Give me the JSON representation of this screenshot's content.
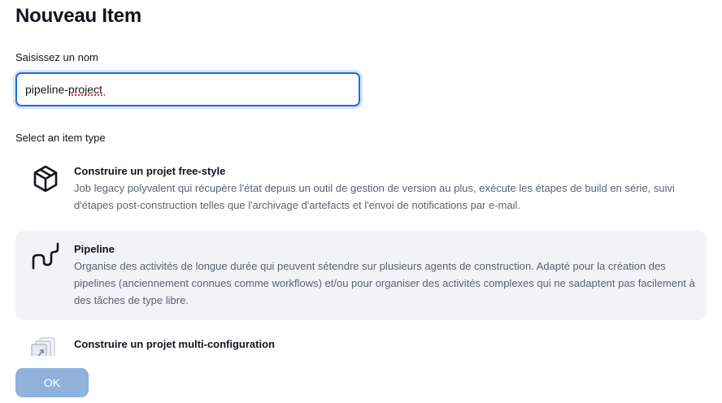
{
  "page_title": "Nouveau Item",
  "name_field": {
    "label": "Saisissez un nom",
    "value": "pipeline-project"
  },
  "item_type_label": "Select an item type",
  "item_types": [
    {
      "name": "Construire un projet free-style",
      "description": "Job legacy polyvalent qui récupère l'état depuis un outil de gestion de version au plus, exécute les étapes de build en série, suivi d'étapes post-construction telles que l'archivage d'artefacts et l'envoi de notifications par e-mail.",
      "icon": "package-box-icon",
      "selected": false
    },
    {
      "name": "Pipeline",
      "description": "Organise des activités de longue durée qui peuvent sétendre sur plusieurs agents de construction. Adapté pour la création des pipelines (anciennement connues comme workflows) et/ou pour organiser des activités complexes qui ne sadaptent pas facilement à des tâches de type libre.",
      "icon": "pipeline-icon",
      "selected": true
    },
    {
      "name": "Construire un projet multi-configuration",
      "description": "",
      "icon": "multi-config-icon",
      "selected": false
    }
  ],
  "ok_button": {
    "label": "OK",
    "color": "#8fb1db"
  },
  "colors": {
    "accent": "#1d6fd6",
    "selected_bg": "#f2f2f7",
    "description_text": "#5a6370"
  }
}
